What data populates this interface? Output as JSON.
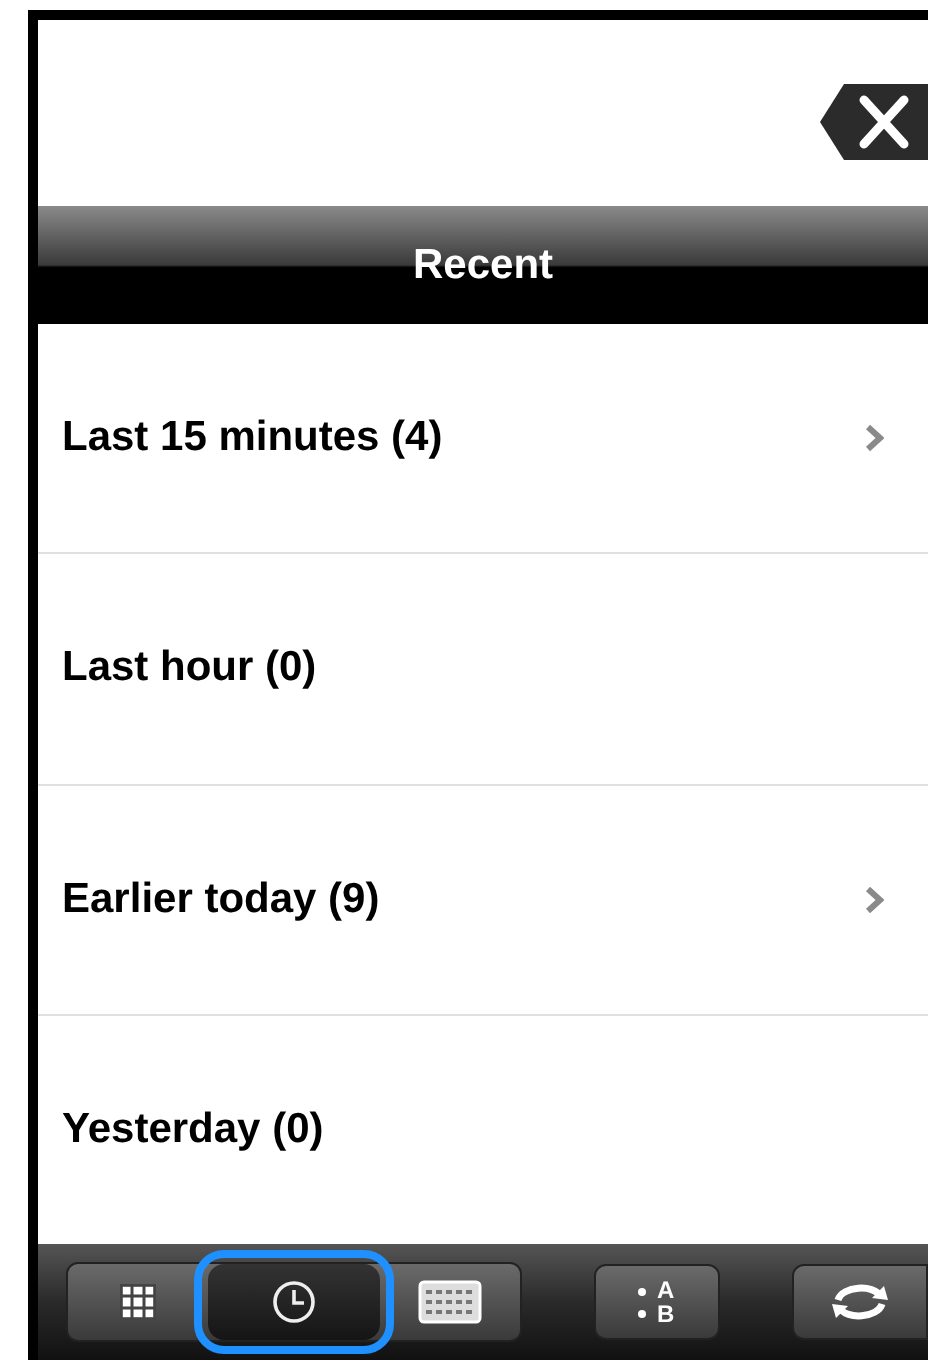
{
  "header": {
    "title": "Recent"
  },
  "rows": [
    {
      "label": "Last 15 minutes (4)",
      "has_chevron": true
    },
    {
      "label": "Last hour (0)",
      "has_chevron": false
    },
    {
      "label": "Earlier today (9)",
      "has_chevron": true
    },
    {
      "label": "Yesterday (0)",
      "has_chevron": false
    }
  ],
  "toolbar": {
    "segments": [
      {
        "kind": "grid",
        "selected": false
      },
      {
        "kind": "clock",
        "selected": true
      },
      {
        "kind": "keyboard",
        "selected": false
      }
    ],
    "sort_button": {
      "top": "A",
      "bottom": "B"
    }
  }
}
